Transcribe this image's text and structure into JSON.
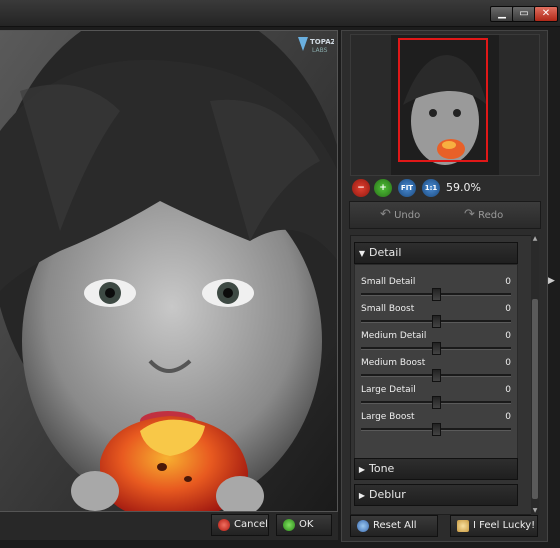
{
  "window": {
    "controls": {
      "minimize": "▁",
      "maximize": "▭",
      "close": "✕"
    }
  },
  "logo": {
    "text": "TOPAZ LABS"
  },
  "navigator": {
    "zoom_level": "59.0%",
    "zoom_buttons": {
      "zoom_out": "−",
      "zoom_in": "+",
      "fit": "FIT",
      "actual": "1:1"
    }
  },
  "history": {
    "undo": "Undo",
    "redo": "Redo"
  },
  "sections": {
    "detail": {
      "label": "Detail",
      "params": [
        {
          "label": "Small Detail",
          "value": "0"
        },
        {
          "label": "Small Boost",
          "value": "0"
        },
        {
          "label": "Medium Detail",
          "value": "0"
        },
        {
          "label": "Medium Boost",
          "value": "0"
        },
        {
          "label": "Large Detail",
          "value": "0"
        },
        {
          "label": "Large Boost",
          "value": "0"
        }
      ]
    },
    "tone": {
      "label": "Tone"
    },
    "deblur": {
      "label": "Deblur"
    }
  },
  "actions": {
    "cancel": "Cancel",
    "ok": "OK",
    "reset_all": "Reset All",
    "lucky": "I Feel Lucky!"
  },
  "colors": {
    "selection_frame": "#e01818",
    "accent_red": "#e03020",
    "accent_green": "#3ea82a"
  }
}
